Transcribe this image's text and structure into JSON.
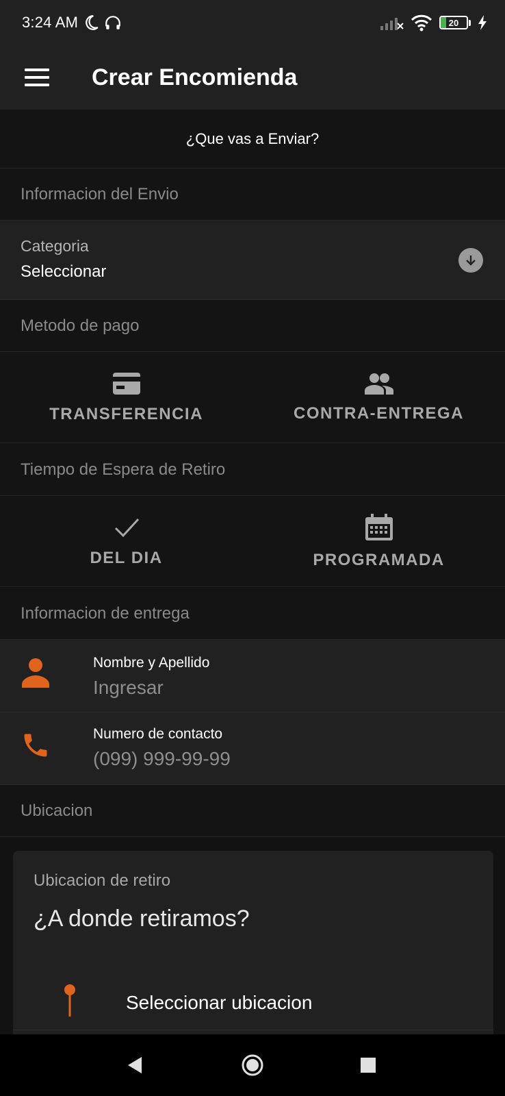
{
  "status_bar": {
    "time": "3:24 AM",
    "battery_percent": "20",
    "battery_level": 0.2
  },
  "app_bar": {
    "title": "Crear Encomienda"
  },
  "what_send": {
    "label": "¿Que vas a Enviar?"
  },
  "shipping_info": {
    "header": "Informacion del Envio",
    "category_label": "Categoria",
    "category_value": "Seleccionar"
  },
  "payment": {
    "header": "Metodo de pago",
    "options": [
      {
        "label": "TRANSFERENCIA",
        "icon": "credit-card-icon"
      },
      {
        "label": "CONTRA-ENTREGA",
        "icon": "people-icon"
      }
    ]
  },
  "wait_time": {
    "header": "Tiempo de Espera de Retiro",
    "options": [
      {
        "label": "DEL DIA",
        "icon": "check-icon"
      },
      {
        "label": "PROGRAMADA",
        "icon": "calendar-icon"
      }
    ]
  },
  "delivery_info": {
    "header": "Informacion de entrega",
    "name_label": "Nombre y Apellido",
    "name_placeholder": "Ingresar",
    "phone_label": "Numero de contacto",
    "phone_placeholder": "(099) 999-99-99"
  },
  "location": {
    "header": "Ubicacion",
    "card_subtitle": "Ubicacion de retiro",
    "card_title": "¿A donde retiramos?",
    "select_label": "Seleccionar ubicacion"
  },
  "colors": {
    "accent": "#e0641e",
    "background": "#121212",
    "surface": "#212121",
    "battery": "#4caf50"
  }
}
